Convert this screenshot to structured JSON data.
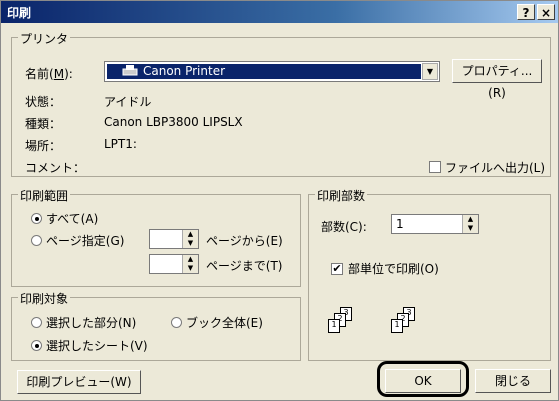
{
  "window": {
    "title": "印刷",
    "help_btn": "?",
    "close_btn": "×"
  },
  "printer": {
    "group_label": "プリンタ",
    "name_label": "名前",
    "name_key": "M",
    "name_value": "Canon Printer",
    "properties_label": "プロパティ...(R)",
    "status_label": "状態：",
    "status_value": "アイドル",
    "type_label": "種類：",
    "type_value": "Canon LBP3800 LIPSLX",
    "location_label": "場所：",
    "location_value": "LPT1:",
    "comment_label": "コメント：",
    "print_to_file_label": "ファイルへ出力(L)"
  },
  "range": {
    "group_label": "印刷範囲",
    "all_label": "すべて(A)",
    "pages_label": "ページ指定(G)",
    "from_label": "ページから(E)",
    "to_label": "ページまで(T)"
  },
  "target": {
    "group_label": "印刷対象",
    "selection_label": "選択した部分(N)",
    "whole_book_label": "ブック全体(E)",
    "selected_sheets_label": "選択したシート(V)"
  },
  "copies": {
    "group_label": "印刷部数",
    "count_label": "部数(C):",
    "count_value": "1",
    "collate_label": "部単位で印刷(O)"
  },
  "footer": {
    "preview_label": "印刷プレビュー(W)",
    "ok_label": "OK",
    "close_label": "閉じる"
  }
}
